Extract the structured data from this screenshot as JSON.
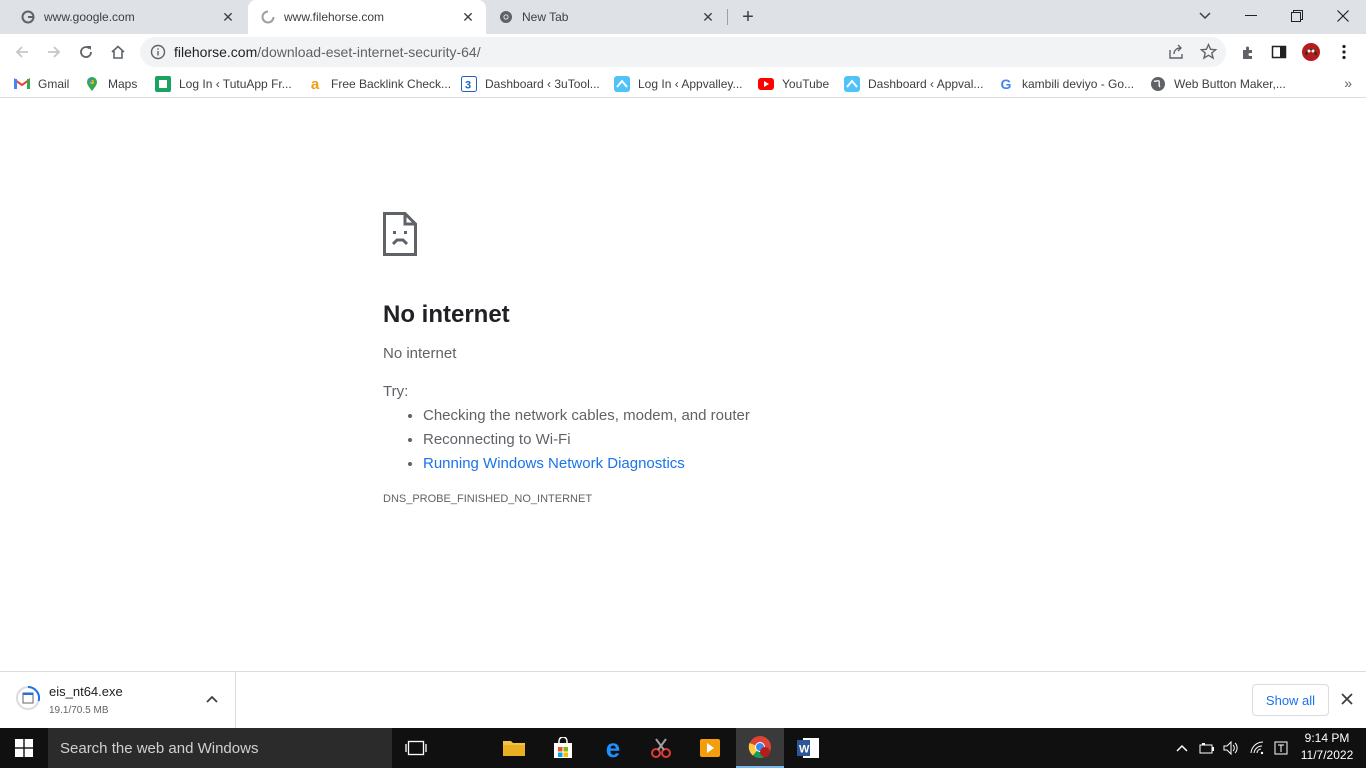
{
  "tabs": [
    {
      "title": "www.google.com",
      "icon": "google-icon"
    },
    {
      "title": "www.filehorse.com",
      "icon": "loading-icon",
      "active": true
    },
    {
      "title": "New Tab",
      "icon": "chrome-icon"
    }
  ],
  "toolbar": {
    "url_host": "filehorse.com",
    "url_path": "/download-eset-internet-security-64/"
  },
  "bookmarks": [
    {
      "label": "Gmail",
      "icon": "gmail-icon"
    },
    {
      "label": "Maps",
      "icon": "maps-icon"
    },
    {
      "label": "Log In ‹ TutuApp Fr...",
      "icon": "tutuapp-icon"
    },
    {
      "label": "Free Backlink Check...",
      "icon": "backlink-icon"
    },
    {
      "label": "Dashboard ‹ 3uTool...",
      "icon": "3utools-icon"
    },
    {
      "label": "Log In ‹ Appvalley...",
      "icon": "appvalley-icon"
    },
    {
      "label": "YouTube",
      "icon": "youtube-icon"
    },
    {
      "label": "Dashboard ‹ Appval...",
      "icon": "appvalley-icon"
    },
    {
      "label": "kambili deviyo - Go...",
      "icon": "google-icon"
    },
    {
      "label": "Web Button Maker,...",
      "icon": "globe-icon"
    }
  ],
  "error": {
    "heading": "No internet",
    "subheading": "No internet",
    "try_label": "Try:",
    "suggestions": [
      "Checking the network cables, modem, and router",
      "Reconnecting to Wi-Fi"
    ],
    "diagnostics_link": "Running Windows Network Diagnostics",
    "code": "DNS_PROBE_FINISHED_NO_INTERNET"
  },
  "download": {
    "filename": "eis_nt64.exe",
    "progress": "19.1/70.5 MB",
    "show_all": "Show all"
  },
  "taskbar": {
    "search_placeholder": "Search the web and Windows",
    "time": "9:14 PM",
    "date": "11/7/2022"
  },
  "colors": {
    "link": "#1a73e8",
    "tabstrip": "#dee1e6",
    "taskbar": "#101010"
  }
}
